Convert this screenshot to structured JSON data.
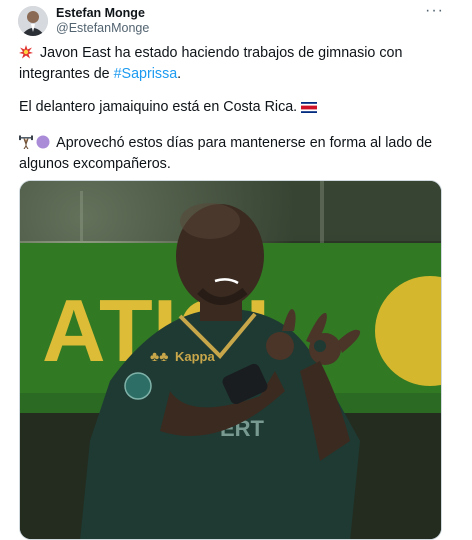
{
  "author": {
    "name": "Estefan Monge",
    "handle": "@EstefanMonge"
  },
  "more_label": "···",
  "tweet": {
    "line1_before": " Javon East ha estado haciendo trabajos de gimnasio con integrantes de ",
    "hashtag": "#Saprissa",
    "line1_after": ".",
    "line2": "El delantero jamaiquino está en Costa Rica. ",
    "line3": " Aprovechó estos días para mantenerse en forma al lado de algunos excompañeros."
  },
  "photo": {
    "banner_text": "ATIOI",
    "shirt_text": "ERT"
  },
  "colors": {
    "hashtag": "#1d9bf0",
    "jersey": "#1e3a33",
    "banner": "#3a8a2a"
  }
}
